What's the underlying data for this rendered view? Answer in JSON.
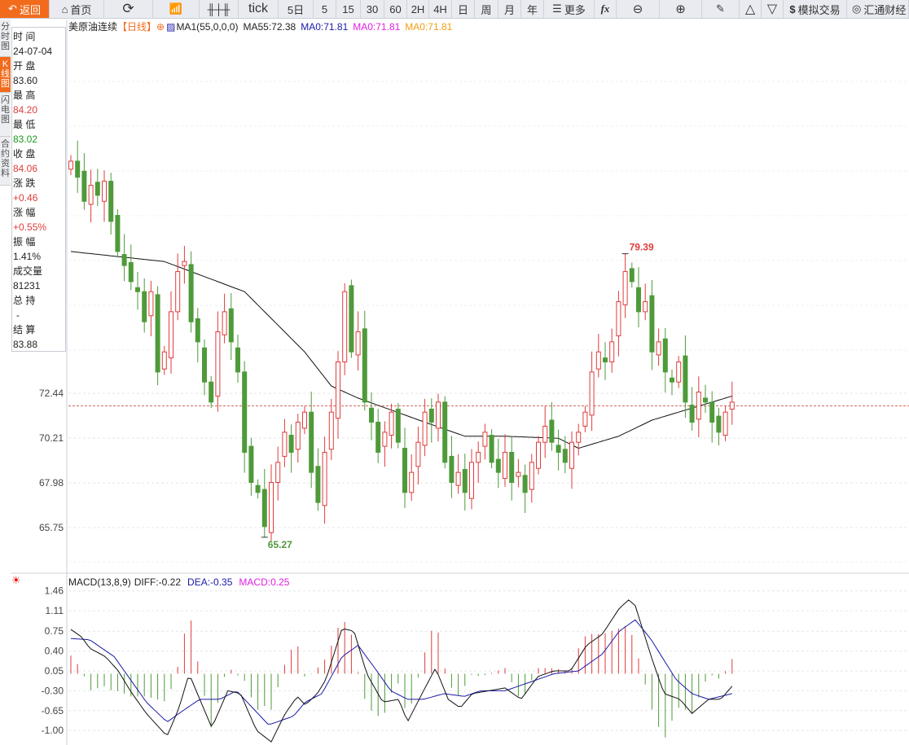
{
  "toolbar": {
    "back": "返回",
    "home": "首页",
    "tick": "tick",
    "periods": [
      "5日",
      "5",
      "15",
      "30",
      "60",
      "2H",
      "4H",
      "日",
      "周",
      "月",
      "年"
    ],
    "more": "更多",
    "fx": "fx",
    "sim_trade": "模拟交易",
    "brand": "汇通财经"
  },
  "side_tabs": [
    "分时图",
    "K线图",
    "闪电图",
    "合约资料"
  ],
  "info": {
    "time_label": "时 间",
    "time": "24-07-04",
    "open_label": "开 盘",
    "open": "83.60",
    "high_label": "最 高",
    "high": "84.20",
    "low_label": "最 低",
    "low": "83.02",
    "close_label": "收 盘",
    "close": "84.06",
    "change_label": "涨 跌",
    "change": "+0.46",
    "pct_label": "涨 幅",
    "pct": "+0.55%",
    "amp_label": "振 幅",
    "amp": "1.41%",
    "vol_label": "成交量",
    "vol": "81231",
    "oi_label": "总 持",
    "oi": "-",
    "settle_label": "结 算",
    "settle": "83.88"
  },
  "legend": {
    "symbol": "美原油连续",
    "period": "【日线】",
    "ma1": "MA1(55,0,0,0)",
    "ma55": "MA55:72.38",
    "ma0a": "MA0:71.81",
    "ma0b": "MA0:71.81",
    "ma0c": "MA0:71.81"
  },
  "macd_legend": {
    "name": "MACD(13,8,9)",
    "diff": "DIFF:-0.22",
    "dea": "DEA:-0.35",
    "macd": "MACD:0.25"
  },
  "colors": {
    "up": "#e03c3c",
    "down": "#4e9a3a",
    "accent": "#f26b1d",
    "dea": "#1a1aa8",
    "macd": "#e020e0",
    "ma0c": "#f39c12"
  },
  "chart_data": [
    {
      "type": "candlestick",
      "title": "美原油连续 日线",
      "y_ticks": [
        "72.44",
        "70.21",
        "67.98",
        "65.75"
      ],
      "ylim": [
        63.3,
        90.4
      ],
      "current_price": 71.81,
      "max_label": "79.39",
      "max_value": 79.39,
      "max_index": 83,
      "min_label": "65.27",
      "min_value": 65.27,
      "min_index": 29,
      "close": [
        84.0,
        83.2,
        82.0,
        82.8,
        82.3,
        83.0,
        81.0,
        79.5,
        78.8,
        78.0,
        77.5,
        76.0,
        77.5,
        73.5,
        74.5,
        76.5,
        78.5,
        79.0,
        76.0,
        75.0,
        73.0,
        72.0,
        75.5,
        76.5,
        75.0,
        73.5,
        69.5,
        68.0,
        67.5,
        65.8,
        68.0,
        69.0,
        70.5,
        69.5,
        71.0,
        71.5,
        68.5,
        67.0,
        69.5,
        71.5,
        74.0,
        77.5,
        74.5,
        75.5,
        72.0,
        71.0,
        69.5,
        70.5,
        71.5,
        70.0,
        67.5,
        68.5,
        70.0,
        71.5,
        71.0,
        72.0,
        69.0,
        68.0,
        68.5,
        67.5,
        69.0,
        69.5,
        70.5,
        69.0,
        68.5,
        69.5,
        68.0,
        68.5,
        67.5,
        69.0,
        70.0,
        70.8,
        70.0,
        69.5,
        69.0,
        70.0,
        70.5,
        71.5,
        73.5,
        74.5,
        74.0,
        75.0,
        77.0,
        78.5,
        78.0,
        76.5,
        77.0,
        74.5,
        75.0,
        73.5,
        73.0,
        74.0,
        72.0,
        71.0,
        72.5,
        72.0,
        71.0,
        70.5,
        71.5,
        72.0
      ],
      "ma55": [
        [
          0,
          79.5
        ],
        [
          14,
          79.0
        ],
        [
          26,
          77.5
        ],
        [
          35,
          74.5
        ],
        [
          39,
          72.8
        ],
        [
          43,
          72.2
        ],
        [
          48,
          71.6
        ],
        [
          53,
          71.0
        ],
        [
          59,
          70.3
        ],
        [
          65,
          70.3
        ],
        [
          73,
          70.2
        ],
        [
          76,
          69.7
        ],
        [
          82,
          70.3
        ],
        [
          87,
          71.1
        ],
        [
          92,
          71.6
        ],
        [
          99,
          72.3
        ]
      ]
    },
    {
      "type": "line+bar",
      "title": "MACD(13,8,9)",
      "y_ticks": [
        "1.46",
        "1.11",
        "0.75",
        "0.40",
        "0.05",
        "-0.30",
        "-0.65",
        "-1.00"
      ],
      "diff": [
        [
          0,
          0.78
        ],
        [
          1.6,
          0.65
        ],
        [
          2.8,
          0.45
        ],
        [
          5.2,
          0.3
        ],
        [
          7.1,
          0.05
        ],
        [
          8.9,
          -0.3
        ],
        [
          11.3,
          -0.7
        ],
        [
          14.4,
          -1.1
        ],
        [
          16.2,
          -0.6
        ],
        [
          17.7,
          0.0
        ],
        [
          19.3,
          -0.45
        ],
        [
          21.1,
          -0.95
        ],
        [
          23.5,
          -0.3
        ],
        [
          25.4,
          -0.35
        ],
        [
          27.8,
          -1.0
        ],
        [
          30,
          -1.2
        ],
        [
          32.1,
          -0.7
        ],
        [
          33.9,
          -0.4
        ],
        [
          35.1,
          -0.55
        ],
        [
          36.9,
          -0.35
        ],
        [
          38.2,
          -0.1
        ],
        [
          40.6,
          0.8
        ],
        [
          42.4,
          0.75
        ],
        [
          44.3,
          0.0
        ],
        [
          46.7,
          -0.5
        ],
        [
          49.1,
          -0.45
        ],
        [
          50.4,
          -0.85
        ],
        [
          52.8,
          -0.3
        ],
        [
          54.6,
          0.1
        ],
        [
          56.5,
          -0.45
        ],
        [
          58.3,
          -0.6
        ],
        [
          60.1,
          -0.35
        ],
        [
          62.6,
          -0.3
        ],
        [
          65,
          -0.25
        ],
        [
          67.4,
          -0.45
        ],
        [
          69.9,
          -0.05
        ],
        [
          72.3,
          0.05
        ],
        [
          74.8,
          0.05
        ],
        [
          77.2,
          0.5
        ],
        [
          79.6,
          0.7
        ],
        [
          82.1,
          1.15
        ],
        [
          83.5,
          1.3
        ],
        [
          84.5,
          1.2
        ],
        [
          86.9,
          0.3
        ],
        [
          88.8,
          -0.35
        ],
        [
          91.2,
          -0.45
        ],
        [
          93,
          -0.7
        ],
        [
          95.5,
          -0.45
        ],
        [
          97.3,
          -0.45
        ],
        [
          99,
          -0.22
        ]
      ],
      "dea": [
        [
          0,
          0.62
        ],
        [
          2.8,
          0.6
        ],
        [
          6.5,
          0.3
        ],
        [
          8.9,
          -0.1
        ],
        [
          11.3,
          -0.5
        ],
        [
          14.4,
          -0.85
        ],
        [
          17.4,
          -0.6
        ],
        [
          19.3,
          -0.45
        ],
        [
          22.3,
          -0.45
        ],
        [
          24.8,
          -0.3
        ],
        [
          27.2,
          -0.6
        ],
        [
          29.6,
          -0.9
        ],
        [
          33.3,
          -0.75
        ],
        [
          35.1,
          -0.5
        ],
        [
          37.6,
          -0.35
        ],
        [
          40.6,
          0.3
        ],
        [
          43,
          0.5
        ],
        [
          45.5,
          0.1
        ],
        [
          47.9,
          -0.3
        ],
        [
          50.4,
          -0.45
        ],
        [
          52.8,
          -0.45
        ],
        [
          55.9,
          -0.35
        ],
        [
          58.9,
          -0.4
        ],
        [
          61.3,
          -0.3
        ],
        [
          65,
          -0.3
        ],
        [
          68.7,
          -0.15
        ],
        [
          72.3,
          0.0
        ],
        [
          76,
          0.05
        ],
        [
          79.6,
          0.35
        ],
        [
          82.1,
          0.75
        ],
        [
          84.5,
          0.95
        ],
        [
          86.9,
          0.6
        ],
        [
          90.6,
          -0.1
        ],
        [
          93,
          -0.35
        ],
        [
          95.5,
          -0.45
        ],
        [
          99,
          -0.35
        ]
      ]
    }
  ]
}
